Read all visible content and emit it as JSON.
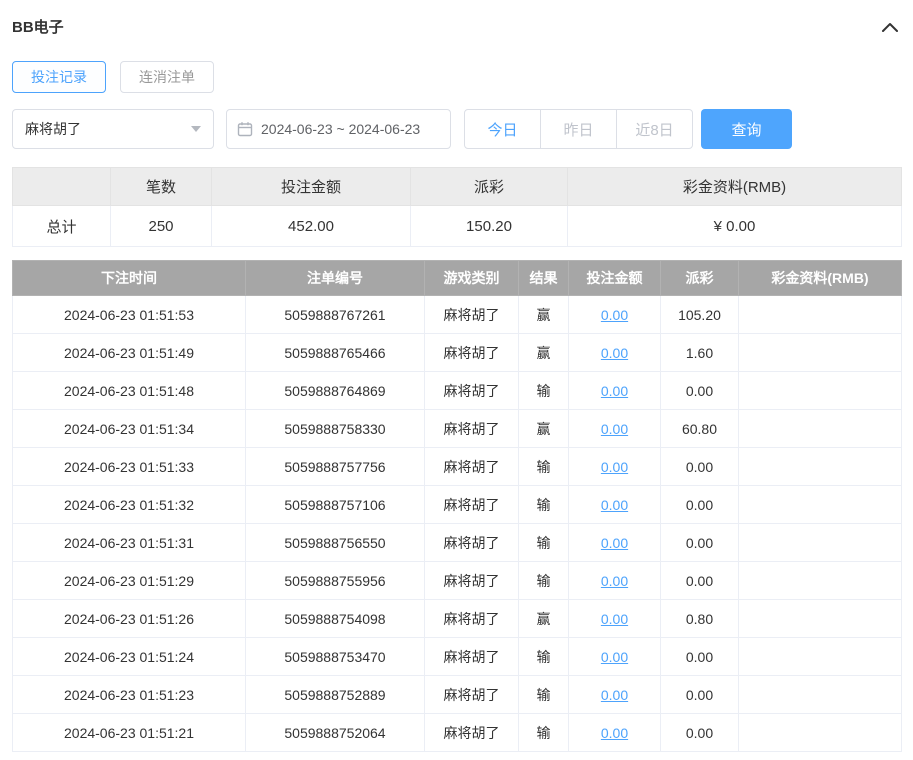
{
  "header": {
    "title": "BB电子"
  },
  "tabs": [
    {
      "label": "投注记录",
      "active": true
    },
    {
      "label": "连消注单",
      "active": false
    }
  ],
  "filters": {
    "game_select_value": "麻将胡了",
    "date_range": "2024-06-23 ~ 2024-06-23",
    "quick_buttons": [
      {
        "label": "今日",
        "active": true
      },
      {
        "label": "昨日",
        "active": false
      },
      {
        "label": "近8日",
        "active": false
      }
    ],
    "search_label": "查询"
  },
  "summary": {
    "headers": [
      "",
      "笔数",
      "投注金额",
      "派彩",
      "彩金资料(RMB)"
    ],
    "row_label": "总计",
    "values": [
      "250",
      "452.00",
      "150.20",
      "¥ 0.00"
    ]
  },
  "table": {
    "headers": [
      "下注时间",
      "注单编号",
      "游戏类别",
      "结果",
      "投注金额",
      "派彩",
      "彩金资料(RMB)"
    ],
    "rows": [
      {
        "time": "2024-06-23 01:51:53",
        "order_id": "5059888767261",
        "game": "麻将胡了",
        "result": "赢",
        "bet": "0.00",
        "payout": "105.20",
        "bonus": ""
      },
      {
        "time": "2024-06-23 01:51:49",
        "order_id": "5059888765466",
        "game": "麻将胡了",
        "result": "赢",
        "bet": "0.00",
        "payout": "1.60",
        "bonus": ""
      },
      {
        "time": "2024-06-23 01:51:48",
        "order_id": "5059888764869",
        "game": "麻将胡了",
        "result": "输",
        "bet": "0.00",
        "payout": "0.00",
        "bonus": ""
      },
      {
        "time": "2024-06-23 01:51:34",
        "order_id": "5059888758330",
        "game": "麻将胡了",
        "result": "赢",
        "bet": "0.00",
        "payout": "60.80",
        "bonus": ""
      },
      {
        "time": "2024-06-23 01:51:33",
        "order_id": "5059888757756",
        "game": "麻将胡了",
        "result": "输",
        "bet": "0.00",
        "payout": "0.00",
        "bonus": ""
      },
      {
        "time": "2024-06-23 01:51:32",
        "order_id": "5059888757106",
        "game": "麻将胡了",
        "result": "输",
        "bet": "0.00",
        "payout": "0.00",
        "bonus": ""
      },
      {
        "time": "2024-06-23 01:51:31",
        "order_id": "5059888756550",
        "game": "麻将胡了",
        "result": "输",
        "bet": "0.00",
        "payout": "0.00",
        "bonus": ""
      },
      {
        "time": "2024-06-23 01:51:29",
        "order_id": "5059888755956",
        "game": "麻将胡了",
        "result": "输",
        "bet": "0.00",
        "payout": "0.00",
        "bonus": ""
      },
      {
        "time": "2024-06-23 01:51:26",
        "order_id": "5059888754098",
        "game": "麻将胡了",
        "result": "赢",
        "bet": "0.00",
        "payout": "0.80",
        "bonus": ""
      },
      {
        "time": "2024-06-23 01:51:24",
        "order_id": "5059888753470",
        "game": "麻将胡了",
        "result": "输",
        "bet": "0.00",
        "payout": "0.00",
        "bonus": ""
      },
      {
        "time": "2024-06-23 01:51:23",
        "order_id": "5059888752889",
        "game": "麻将胡了",
        "result": "输",
        "bet": "0.00",
        "payout": "0.00",
        "bonus": ""
      },
      {
        "time": "2024-06-23 01:51:21",
        "order_id": "5059888752064",
        "game": "麻将胡了",
        "result": "输",
        "bet": "0.00",
        "payout": "0.00",
        "bonus": ""
      }
    ]
  },
  "colors": {
    "accent_blue": "#4da3fc",
    "table_header_gray": "#a6a6a6",
    "summary_header_gray": "#ececec"
  }
}
